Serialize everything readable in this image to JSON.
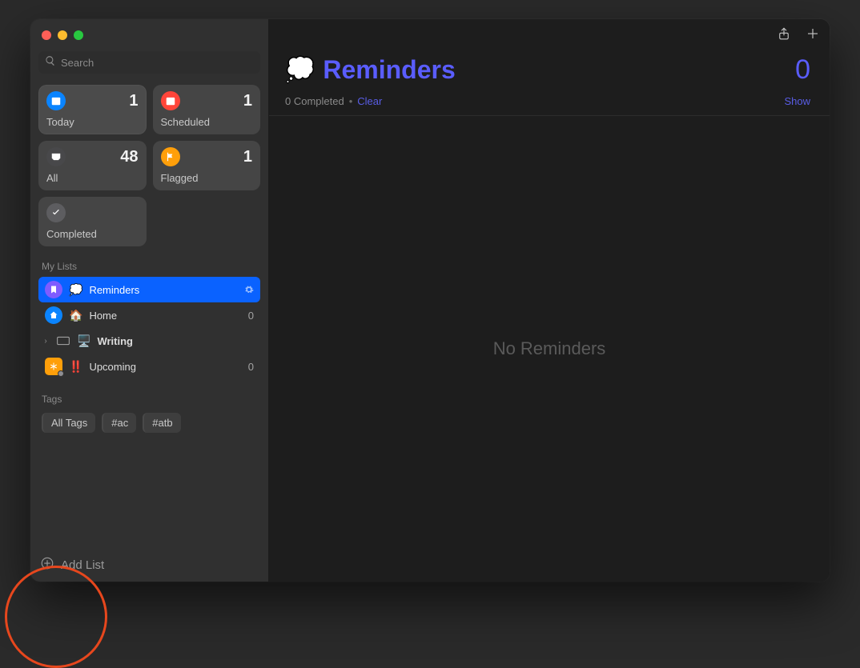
{
  "search": {
    "placeholder": "Search"
  },
  "smart": {
    "today": {
      "label": "Today",
      "count": "1"
    },
    "scheduled": {
      "label": "Scheduled",
      "count": "1"
    },
    "all": {
      "label": "All",
      "count": "48"
    },
    "flagged": {
      "label": "Flagged",
      "count": "1"
    },
    "completed": {
      "label": "Completed",
      "count": ""
    }
  },
  "mylists_header": "My Lists",
  "lists": {
    "reminders": {
      "emoji": "💭",
      "name": "Reminders",
      "count": ""
    },
    "home": {
      "emoji": "🏠",
      "name": "Home",
      "count": "0"
    },
    "writing": {
      "emoji": "🖥️",
      "name": "Writing",
      "count": ""
    },
    "upcoming": {
      "emoji": "‼️",
      "name": "Upcoming",
      "count": "0"
    }
  },
  "tags_header": "Tags",
  "tags": {
    "all": "All Tags",
    "t1": "#ac",
    "t2": "#atb"
  },
  "add_list_label": "Add List",
  "main": {
    "title_emoji": "💭",
    "title": "Reminders",
    "big_count": "0",
    "completed_text": "0 Completed",
    "clear": "Clear",
    "show": "Show",
    "empty": "No Reminders"
  }
}
